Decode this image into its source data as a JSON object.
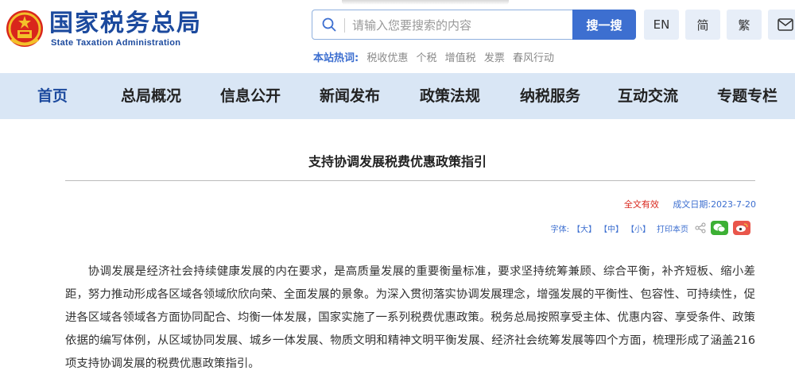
{
  "header": {
    "site_title": "国家税务总局",
    "site_subtitle": "State Taxation Administration",
    "emblem_icon": "national-emblem-icon"
  },
  "search": {
    "placeholder": "请输入您要搜索的内容",
    "button_label": "搜一搜"
  },
  "lang": {
    "en": "EN",
    "simplified": "简",
    "traditional": "繁"
  },
  "hot": {
    "label": "本站热词:",
    "items": [
      "税收优惠",
      "个税",
      "增值税",
      "发票",
      "春风行动"
    ]
  },
  "nav": {
    "items": [
      "首页",
      "总局概况",
      "信息公开",
      "新闻发布",
      "政策法规",
      "纳税服务",
      "互动交流",
      "专题专栏"
    ]
  },
  "article": {
    "title": "支持协调发展税费优惠政策指引",
    "validity": "全文有效",
    "pub_label": "成文日期:",
    "pub_date": "2023-7-20",
    "font_label": "字体:",
    "font_large": "【大】",
    "font_medium": "【中】",
    "font_small": "【小】",
    "print_label": "打印本页",
    "body": "协调发展是经济社会持续健康发展的内在要求，是高质量发展的重要衡量标准，要求坚持统筹兼顾、综合平衡，补齐短板、缩小差距，努力推动形成各区域各领域欣欣向荣、全面发展的景象。为深入贯彻落实协调发展理念，增强发展的平衡性、包容性、可持续性，促进各区域各领域各方面协同配合、均衡一体发展，国家实施了一系列税费优惠政策。税务总局按照享受主体、优惠内容、享受条件、政策依据的编写体例，从区域协同发展、城乡一体发展、物质文明和精神文明平衡发展、经济社会统筹发展等四个方面，梳理形成了涵盖216项支持协调发展的税费优惠政策指引。"
  },
  "colors": {
    "brand_blue": "#1c4a9e",
    "accent_blue": "#3d6fd0",
    "nav_bg": "#d9e6f5",
    "validity_red": "#d9261c"
  }
}
